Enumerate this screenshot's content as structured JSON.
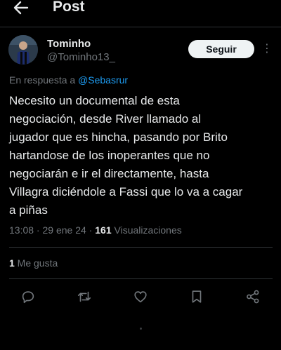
{
  "header": {
    "title": "Post"
  },
  "author": {
    "name": "Tominho",
    "handle": "@Tominho13_",
    "follow_label": "Seguir"
  },
  "reply": {
    "prefix": "En respuesta a ",
    "user": "@Sebasrur"
  },
  "tweet": {
    "lines": [
      "Necesito un documental de esta",
      "negociación, desde River llamado al",
      "jugador que es hincha, pasando por Brito",
      "hartandose de los inoperantes que no",
      "negociarán e ir el directamente, hasta",
      "Villagra diciéndole a Fassi que lo va a cagar",
      "a piñas"
    ]
  },
  "meta": {
    "time": "13:08",
    "date": "29 ene 24",
    "separator": " · ",
    "views_count": "161",
    "views_label": " Visualizaciones"
  },
  "stats": {
    "likes_count": "1",
    "likes_label": " Me gusta"
  },
  "colors": {
    "background": "#000000",
    "text": "#e7e9ea",
    "muted": "#71767b",
    "link": "#1d9bf0",
    "divider": "#2f3336"
  }
}
